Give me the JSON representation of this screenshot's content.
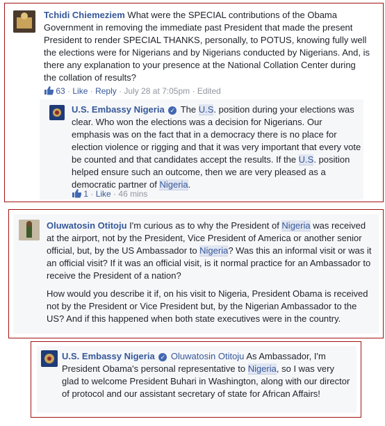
{
  "comment1": {
    "author": "Tchidi Chiemeziem",
    "text": "What were the SPECIAL contributions of the Obama Government in removing the immediate past President that made the present President to render SPECIAL THANKS, personally, to POTUS, knowing fully well the elections were for Nigerians and by Nigerians conducted by Nigerians. And, is there any explanation to your presence at the National Collation Center during the collation of results?",
    "likes": "63",
    "like_label": "Like",
    "reply_label": "Reply",
    "time": "July 28 at 7:05pm",
    "edited": "Edited",
    "reply": {
      "author": "U.S. Embassy Nigeria",
      "text_parts": [
        "The ",
        "U.S",
        ". position during your elections was clear. Who won the elections was a decision for Nigerians. Our emphasis was on the fact that in a democracy there is no place for election violence or rigging and that it was very important that every vote be counted and that candidates accept the results. If the ",
        "U.S",
        ". position helped ensure such an outcome, then we are very pleased as a democratic partner of ",
        "Nigeria",
        "."
      ],
      "likes": "1",
      "like_label": "Like",
      "time": "46 mins"
    }
  },
  "comment2": {
    "author": "Oluwatosin Otitoju",
    "para1_parts": [
      "I'm curious as to why the President of ",
      "Nigeria",
      " was received at the airport, not by the President, Vice President of America or another senior official, but, by the US Ambassador to ",
      "Nigeria",
      "? Was this an informal visit or was it an official visit? If it was an official visit, is it normal practice for an Ambassador to receive the President of a nation?"
    ],
    "para2": "How would you describe it if, on his visit to Nigeria, President Obama is received not by the President or Vice President but, by the Nigerian Ambassador to the US? And if this happened when both state executives were in the country."
  },
  "comment3": {
    "author": "U.S. Embassy Nigeria",
    "mention": "Oluwatosin Otitoju",
    "text_parts": [
      " As Ambassador, I'm President Obama's personal representative to ",
      "Nigeria",
      ", so I was very glad to welcome President Buhari in Washington, along with our director of protocol and our assistant secretary of state for African Affairs!"
    ]
  },
  "colors": {
    "frame": "#a01010",
    "link": "#365899",
    "meta": "#90949c",
    "panel": "#f6f7f9"
  }
}
